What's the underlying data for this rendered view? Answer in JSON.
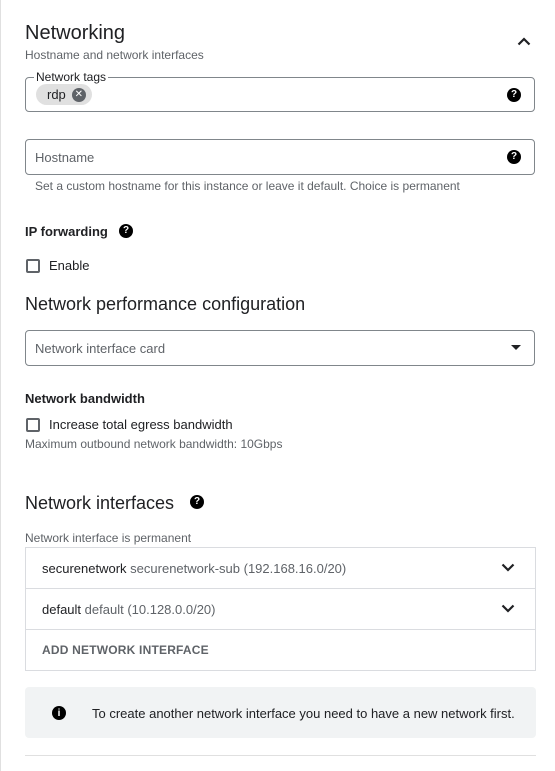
{
  "section": {
    "title": "Networking",
    "subtitle": "Hostname and network interfaces"
  },
  "network_tags": {
    "label": "Network tags",
    "tags": [
      {
        "text": "rdp"
      }
    ]
  },
  "hostname": {
    "placeholder": "Hostname",
    "hint": "Set a custom hostname for this instance or leave it default. Choice is permanent"
  },
  "ip_forwarding": {
    "label": "IP forwarding",
    "checkbox_label": "Enable",
    "checked": false
  },
  "performance": {
    "heading": "Network performance configuration",
    "nic_placeholder": "Network interface card",
    "bandwidth_label": "Network bandwidth",
    "egress_checkbox_label": "Increase total egress bandwidth",
    "egress_checked": false,
    "max_outbound": "Maximum outbound network bandwidth: 10Gbps"
  },
  "interfaces": {
    "heading": "Network interfaces",
    "permanent_note": "Network interface is permanent",
    "items": [
      {
        "network": "securenetwork",
        "detail": "securenetwork-sub (192.168.16.0/20)"
      },
      {
        "network": "default",
        "detail": "default (10.128.0.0/20)"
      }
    ],
    "add_label": "ADD NETWORK INTERFACE",
    "info_text": "To create another network interface you need to have a new network first."
  },
  "icons": {
    "collapse": "chevron-up-icon",
    "help": "help-icon",
    "info": "info-icon",
    "expand": "chevron-down-icon",
    "remove_chip": "close-circle-icon"
  }
}
